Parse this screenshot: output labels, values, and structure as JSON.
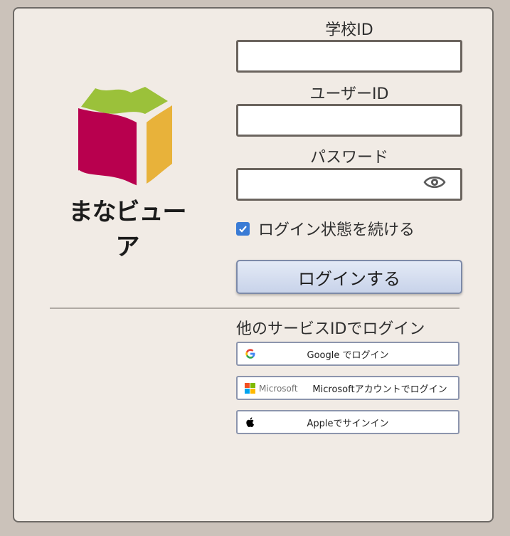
{
  "brand": {
    "name": "まなビューア"
  },
  "form": {
    "school_id_label": "学校ID",
    "school_id_value": "",
    "user_id_label": "ユーザーID",
    "user_id_value": "",
    "password_label": "パスワード",
    "password_value": "",
    "remember_label": "ログイン状態を続ける",
    "remember_checked": true,
    "login_button": "ログインする"
  },
  "sso": {
    "section_label": "他のサービスIDでログイン",
    "google": "Google でログイン",
    "microsoft_brand": "Microsoft",
    "microsoft": "Microsoftアカウントでログイン",
    "apple": "Appleでサインイン"
  },
  "colors": {
    "book_magenta": "#b8004e",
    "book_green": "#9bc13a",
    "book_yellow": "#e8b23a",
    "checkbox": "#3a7bd5"
  },
  "icons": {
    "password_toggle": "eye-icon",
    "google": "google-icon",
    "microsoft": "microsoft-icon",
    "apple": "apple-icon"
  }
}
